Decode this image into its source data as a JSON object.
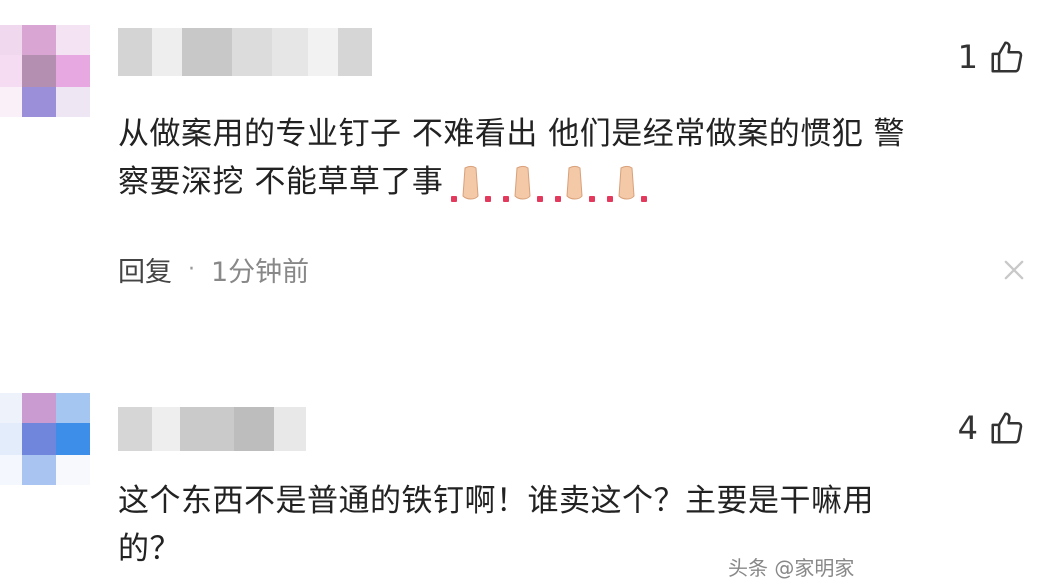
{
  "comments": [
    {
      "likes": "1",
      "text_line1": "从做案用的专业钉子 不难看出 他们是经常做案的惯犯 警",
      "text_line2": "察要深挖 不能草草了事",
      "emojis": [
        "pray-icon",
        "pray-icon",
        "pray-icon",
        "pray-icon"
      ],
      "reply_label": "回复",
      "separator": "·",
      "time": "1分钟前",
      "close_glyph": "×"
    },
    {
      "likes": "4",
      "text_line1": "这个东西不是普通的铁钉啊！谁卖这个？主要是干嘛用",
      "text_line2": "的？"
    }
  ],
  "watermark": "头条 @家明家",
  "colors": {
    "text": "#222222",
    "meta": "#888888",
    "icon": "#333333"
  }
}
